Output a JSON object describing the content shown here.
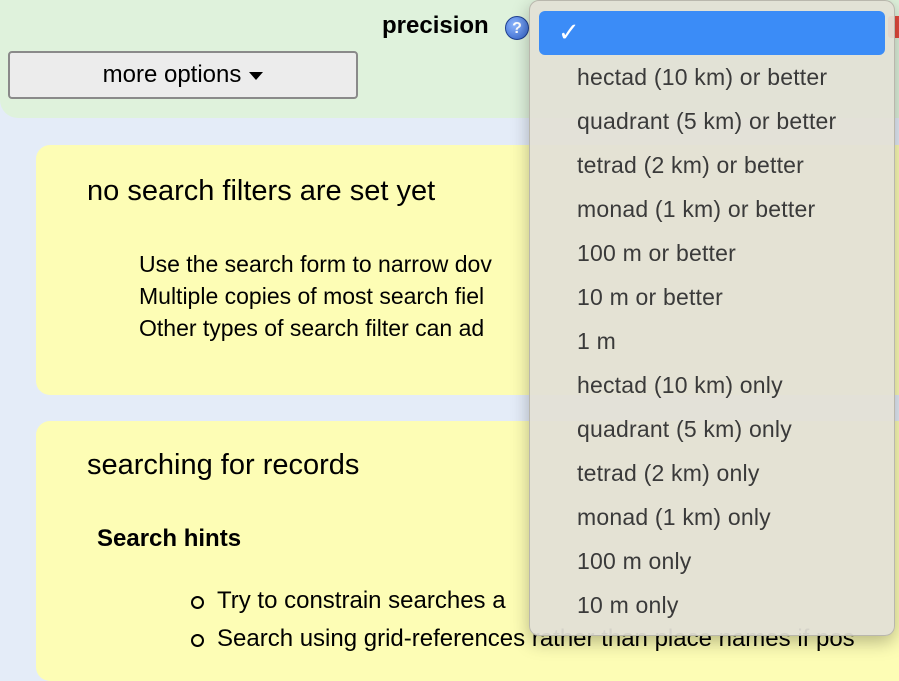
{
  "filter_bar": {
    "precision_label": "precision",
    "help_icon_glyph": "?",
    "more_options_label": "more options"
  },
  "panels": {
    "no_filters": {
      "title": "no search filters are set yet",
      "lines": [
        "Use the search form to narrow dov",
        "Multiple copies of most search fiel",
        "Other types of search filter can ad"
      ]
    },
    "searching": {
      "title": "searching for records",
      "hints_heading": "Search hints",
      "hints": [
        "Try to constrain searches a",
        "Search using grid-references rather than place names if pos"
      ]
    }
  },
  "precision_dropdown": {
    "selected_option": "",
    "check_icon": "checkmark-icon",
    "check_glyph": "✓",
    "options": [
      "hectad (10 km) or better",
      "quadrant (5 km) or better",
      "tetrad (2 km) or better",
      "monad (1 km) or better",
      "100 m or better",
      "10 m or better",
      "1 m",
      "hectad (10 km) only",
      "quadrant (5 km) only",
      "tetrad (2 km) only",
      "monad (1 km) only",
      "100 m only",
      "10 m only"
    ]
  },
  "colors": {
    "filter_bar_bg": "#dff2dc",
    "panel_bg": "#fdfdb5",
    "page_bg": "#e4ecf8",
    "selected_highlight": "#3b8cf7"
  }
}
